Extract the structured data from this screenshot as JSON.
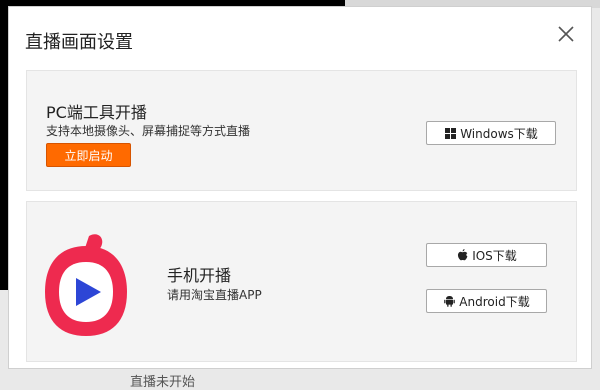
{
  "background": {
    "bottom_text": "直播未开始"
  },
  "modal": {
    "title": "直播画面设置"
  },
  "pc_panel": {
    "title": "PC端工具开播",
    "description": "支持本地摄像头、屏幕捕捉等方式直播",
    "start_button": "立即启动",
    "windows_download": "Windows下载"
  },
  "mobile_panel": {
    "title": "手机开播",
    "description": "请用淘宝直播APP",
    "ios_download": "IOS下载",
    "android_download": "Android下载"
  },
  "colors": {
    "accent": "#ff6a00",
    "logo_red": "#ee2a4f",
    "logo_blue": "#2d46d6"
  },
  "icons": [
    "close-icon",
    "windows-icon",
    "apple-icon",
    "android-icon",
    "taobao-live-logo"
  ]
}
